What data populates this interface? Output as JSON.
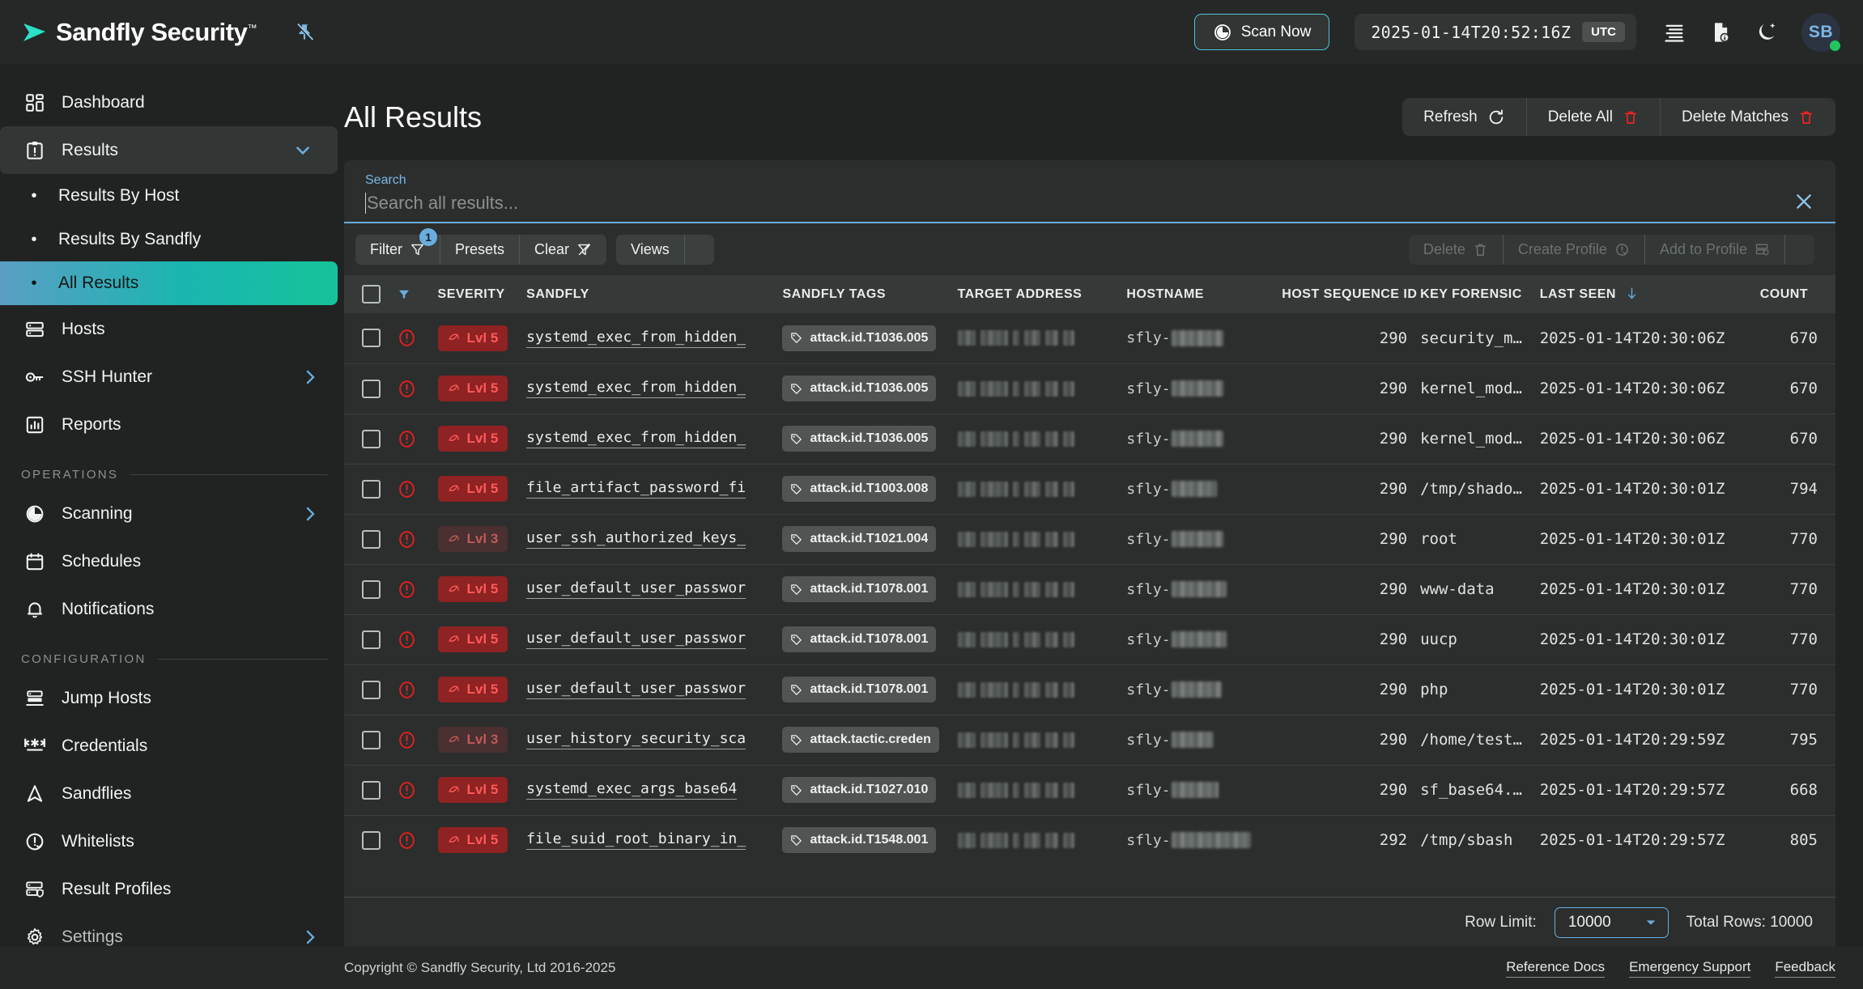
{
  "brand": {
    "name": "Sandfly Security",
    "tm": "™",
    "pin_icon": "pin-off-icon"
  },
  "header": {
    "scan_now_label": "Scan Now",
    "scan_icon": "scan-target-icon",
    "timestamp": "2025-01-14T20:52:16Z",
    "timezone": "UTC",
    "icons": [
      "list-activity-icon",
      "document-info-icon",
      "moon-dark-mode-icon"
    ],
    "avatar_initials": "SB",
    "status_color": "#22c55e",
    "accent_color": "#4ec3e0"
  },
  "sidebar": {
    "items": [
      {
        "label": "Dashboard",
        "icon": "dashboard-grid-icon",
        "kind": "item"
      },
      {
        "label": "Results",
        "icon": "clipboard-alert-icon",
        "kind": "group",
        "expanded": true,
        "caret": "chevron-down-icon"
      },
      {
        "label": "Results By Host",
        "kind": "sub",
        "selected": false
      },
      {
        "label": "Results By Sandfly",
        "kind": "sub",
        "selected": false
      },
      {
        "label": "All Results",
        "kind": "sub",
        "selected": true
      },
      {
        "label": "Hosts",
        "icon": "server-stack-icon",
        "kind": "item"
      },
      {
        "label": "SSH Hunter",
        "icon": "key-icon",
        "kind": "item",
        "caret": "chevron-right-icon"
      },
      {
        "label": "Reports",
        "icon": "bar-chart-icon",
        "kind": "item"
      }
    ],
    "section_operations": {
      "title": "OPERATIONS",
      "items": [
        {
          "label": "Scanning",
          "icon": "scan-target-icon",
          "caret": "chevron-right-icon"
        },
        {
          "label": "Schedules",
          "icon": "calendar-icon"
        },
        {
          "label": "Notifications",
          "icon": "bell-icon"
        }
      ]
    },
    "section_configuration": {
      "title": "CONFIGURATION",
      "items": [
        {
          "label": "Jump Hosts",
          "icon": "jump-host-icon"
        },
        {
          "label": "Credentials",
          "icon": "asterisk-password-icon"
        },
        {
          "label": "Sandflies",
          "icon": "sandfly-arrow-icon"
        },
        {
          "label": "Whitelists",
          "icon": "alert-check-icon"
        },
        {
          "label": "Result Profiles",
          "icon": "server-shield-icon"
        },
        {
          "label": "Settings",
          "icon": "gear-icon",
          "caret": "chevron-right-icon",
          "dim": true
        }
      ]
    }
  },
  "main": {
    "page_title": "All Results",
    "actions": [
      {
        "label": "Refresh",
        "icon": "refresh-icon"
      },
      {
        "label": "Delete All",
        "icon": "trash-icon",
        "icon_color": "#ff2020"
      },
      {
        "label": "Delete Matches",
        "icon": "trash-icon",
        "icon_color": "#ff2020"
      }
    ],
    "search": {
      "label": "Search",
      "value": "",
      "placeholder": "Search all results...",
      "clear_icon": "close-x-icon"
    },
    "toolbar_left": [
      {
        "label": "Filter",
        "icon": "filter-icon",
        "badge": "1"
      },
      {
        "label": "Presets",
        "icon": ""
      },
      {
        "label": "Clear",
        "icon": "filter-off-icon"
      }
    ],
    "toolbar_left_2": [
      {
        "label": "Views",
        "icon": ""
      },
      {
        "label": "",
        "icon": "more-vertical-icon"
      }
    ],
    "toolbar_right": [
      {
        "label": "Delete",
        "icon": "trash-icon"
      },
      {
        "label": "Create Profile",
        "icon": "alert-check-icon"
      },
      {
        "label": "Add to Profile",
        "icon": "server-shield-icon"
      },
      {
        "label": "",
        "icon": "more-vertical-icon"
      }
    ],
    "toolbar_right_disabled": true
  },
  "table": {
    "columns": [
      {
        "key": "checkbox",
        "label": ""
      },
      {
        "key": "flag",
        "label": "",
        "icon": "filter-icon"
      },
      {
        "key": "severity",
        "label": "SEVERITY"
      },
      {
        "key": "sandfly",
        "label": "SANDFLY"
      },
      {
        "key": "tags",
        "label": "SANDFLY TAGS"
      },
      {
        "key": "address",
        "label": "TARGET ADDRESS"
      },
      {
        "key": "hostname",
        "label": "HOSTNAME"
      },
      {
        "key": "host_sequence_id",
        "label": "HOST SEQUENCE ID"
      },
      {
        "key": "key_forensic",
        "label": "KEY FORENSIC"
      },
      {
        "key": "last_seen",
        "label": "LAST SEEN",
        "sort": "desc",
        "sort_icon": "arrow-down-icon"
      },
      {
        "key": "count",
        "label": "COUNT"
      }
    ],
    "rows": [
      {
        "severity_icon": "alert-circle-icon",
        "level": "Lvl 5",
        "level_class": "lvl-5",
        "sandfly": "systemd_exec_from_hidden_",
        "tag": "attack.id.T1036.005",
        "address": "redacted",
        "hostname_prefix": "sfly-",
        "hostname_blur_w": 64,
        "host_sequence_id": "290",
        "key_forensic": "security_m…",
        "last_seen": "2025-01-14T20:30:06Z",
        "count": "670"
      },
      {
        "severity_icon": "alert-circle-icon",
        "level": "Lvl 5",
        "level_class": "lvl-5",
        "sandfly": "systemd_exec_from_hidden_",
        "tag": "attack.id.T1036.005",
        "address": "redacted",
        "hostname_prefix": "sfly-",
        "hostname_blur_w": 64,
        "host_sequence_id": "290",
        "key_forensic": "kernel_mod…",
        "last_seen": "2025-01-14T20:30:06Z",
        "count": "670"
      },
      {
        "severity_icon": "alert-circle-icon",
        "level": "Lvl 5",
        "level_class": "lvl-5",
        "sandfly": "systemd_exec_from_hidden_",
        "tag": "attack.id.T1036.005",
        "address": "redacted",
        "hostname_prefix": "sfly-",
        "hostname_blur_w": 64,
        "host_sequence_id": "290",
        "key_forensic": "kernel_mod…",
        "last_seen": "2025-01-14T20:30:06Z",
        "count": "670"
      },
      {
        "severity_icon": "alert-circle-icon",
        "level": "Lvl 5",
        "level_class": "lvl-5",
        "sandfly": "file_artifact_password_fi",
        "tag": "attack.id.T1003.008",
        "address": "redacted",
        "hostname_prefix": "sfly-",
        "hostname_blur_w": 56,
        "host_sequence_id": "290",
        "key_forensic": "/tmp/shado…",
        "last_seen": "2025-01-14T20:30:01Z",
        "count": "794"
      },
      {
        "severity_icon": "alert-circle-icon",
        "level": "Lvl 3",
        "level_class": "lvl-3",
        "sandfly": "user_ssh_authorized_keys_",
        "tag": "attack.id.T1021.004",
        "address": "redacted",
        "hostname_prefix": "sfly-",
        "hostname_blur_w": 64,
        "host_sequence_id": "290",
        "key_forensic": "root",
        "last_seen": "2025-01-14T20:30:01Z",
        "count": "770"
      },
      {
        "severity_icon": "alert-circle-icon",
        "level": "Lvl 5",
        "level_class": "lvl-5",
        "sandfly": "user_default_user_passwor",
        "tag": "attack.id.T1078.001",
        "address": "redacted",
        "hostname_prefix": "sfly-",
        "hostname_blur_w": 68,
        "host_sequence_id": "290",
        "key_forensic": "www-data",
        "last_seen": "2025-01-14T20:30:01Z",
        "count": "770"
      },
      {
        "severity_icon": "alert-circle-icon",
        "level": "Lvl 5",
        "level_class": "lvl-5",
        "sandfly": "user_default_user_passwor",
        "tag": "attack.id.T1078.001",
        "address": "redacted",
        "hostname_prefix": "sfly-",
        "hostname_blur_w": 68,
        "host_sequence_id": "290",
        "key_forensic": "uucp",
        "last_seen": "2025-01-14T20:30:01Z",
        "count": "770"
      },
      {
        "severity_icon": "alert-circle-icon",
        "level": "Lvl 5",
        "level_class": "lvl-5",
        "sandfly": "user_default_user_passwor",
        "tag": "attack.id.T1078.001",
        "address": "redacted",
        "hostname_prefix": "sfly-",
        "hostname_blur_w": 62,
        "host_sequence_id": "290",
        "key_forensic": "php",
        "last_seen": "2025-01-14T20:30:01Z",
        "count": "770"
      },
      {
        "severity_icon": "alert-circle-icon",
        "level": "Lvl 3",
        "level_class": "lvl-3",
        "sandfly": "user_history_security_sca",
        "tag": "attack.tactic.creden",
        "address": "redacted",
        "hostname_prefix": "sfly-",
        "hostname_blur_w": 52,
        "host_sequence_id": "290",
        "key_forensic": "/home/test…",
        "last_seen": "2025-01-14T20:29:59Z",
        "count": "795"
      },
      {
        "severity_icon": "alert-circle-icon",
        "level": "Lvl 5",
        "level_class": "lvl-5",
        "sandfly": "systemd_exec_args_base64",
        "tag": "attack.id.T1027.010",
        "address": "redacted",
        "hostname_prefix": "sfly-",
        "hostname_blur_w": 58,
        "host_sequence_id": "290",
        "key_forensic": "sf_base64.…",
        "last_seen": "2025-01-14T20:29:57Z",
        "count": "668"
      },
      {
        "severity_icon": "alert-circle-icon",
        "level": "Lvl 5",
        "level_class": "lvl-5",
        "sandfly": "file_suid_root_binary_in_",
        "tag": "attack.id.T1548.001",
        "address": "redacted",
        "hostname_prefix": "sfly-",
        "hostname_blur_w": 98,
        "host_sequence_id": "292",
        "key_forensic": "/tmp/sbash",
        "last_seen": "2025-01-14T20:29:57Z",
        "count": "805"
      }
    ]
  },
  "panel_footer": {
    "row_limit_label": "Row Limit:",
    "row_limit_value": "10000",
    "row_limit_caret": "chevron-down-icon",
    "total_rows": "Total Rows: 10000"
  },
  "footer": {
    "copyright": "Copyright © Sandfly Security, Ltd 2016-2025",
    "links": [
      "Reference Docs",
      "Emergency Support",
      "Feedback"
    ]
  }
}
